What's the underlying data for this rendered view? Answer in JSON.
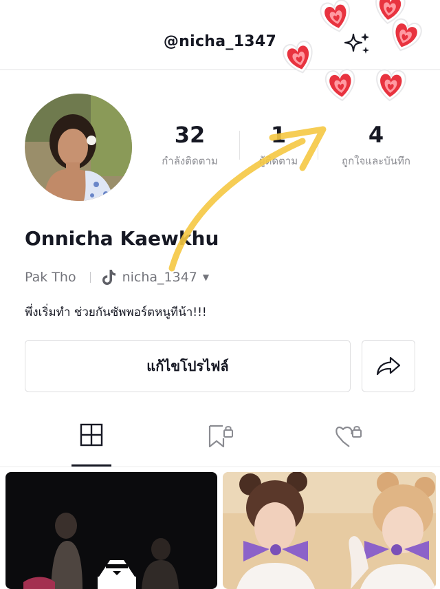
{
  "header": {
    "username": "@nicha_1347"
  },
  "profile": {
    "name": "Onnicha Kaewkhu",
    "location": "Pak Tho",
    "tiktok_handle": "nicha_1347",
    "bio": "พึ่งเริ่มทำ ช่วยกันซัพพอร์ตหนูทีน้า!!!"
  },
  "stats": [
    {
      "value": "32",
      "label": "กำลังติดตาม"
    },
    {
      "value": "1",
      "label": "ผู้ติดตาม"
    },
    {
      "value": "4",
      "label": "ถูกใจและบันทึก"
    }
  ],
  "actions": {
    "edit_profile": "แก้ไขโปรไฟล์"
  },
  "tabs": [
    {
      "icon": "grid-icon",
      "active": true
    },
    {
      "icon": "bookmark-lock-icon",
      "active": false
    },
    {
      "icon": "heart-lock-icon",
      "active": false
    }
  ],
  "colors": {
    "text": "#161823",
    "muted": "#8a8b91",
    "sticker_heart": "#e8333f",
    "annotation_arrow": "#f5c842"
  }
}
